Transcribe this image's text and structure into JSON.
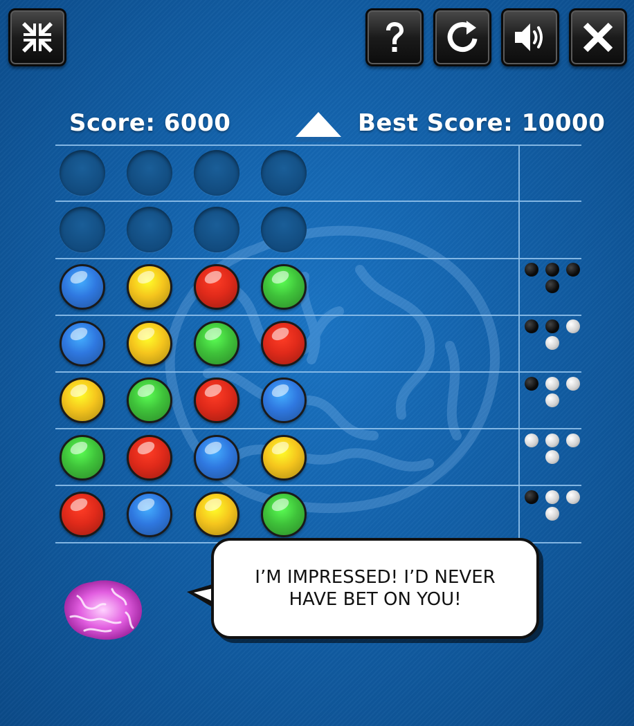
{
  "toolbar": {
    "buttons": [
      {
        "name": "fullscreen-toggle-button",
        "icon": "compress-arrows-icon"
      },
      {
        "name": "help-button",
        "icon": "question-mark-icon"
      },
      {
        "name": "restart-button",
        "icon": "restart-icon"
      },
      {
        "name": "sound-button",
        "icon": "speaker-icon"
      },
      {
        "name": "close-button",
        "icon": "close-icon"
      }
    ]
  },
  "score": {
    "label": "Score: 6000",
    "value": 6000
  },
  "best_score": {
    "label": "Best Score: 10000",
    "value": 10000
  },
  "colors": {
    "blue": "#2f78e0",
    "yellow": "#f5c51d",
    "red": "#e02a1a",
    "green": "#3fc23a"
  },
  "board": {
    "rows": [
      {
        "pegs": [
          "empty",
          "empty",
          "empty",
          "empty"
        ],
        "hints": []
      },
      {
        "pegs": [
          "empty",
          "empty",
          "empty",
          "empty"
        ],
        "hints": []
      },
      {
        "pegs": [
          "blue",
          "yellow",
          "red",
          "green"
        ],
        "hints": [
          "black",
          "black",
          "black",
          "black"
        ]
      },
      {
        "pegs": [
          "blue",
          "yellow",
          "green",
          "red"
        ],
        "hints": [
          "black",
          "black",
          "white",
          "white"
        ]
      },
      {
        "pegs": [
          "yellow",
          "green",
          "red",
          "blue"
        ],
        "hints": [
          "black",
          "white",
          "white",
          "white"
        ]
      },
      {
        "pegs": [
          "green",
          "red",
          "blue",
          "yellow"
        ],
        "hints": [
          "white",
          "white",
          "white",
          "white"
        ]
      },
      {
        "pegs": [
          "red",
          "blue",
          "yellow",
          "green"
        ],
        "hints": [
          "black",
          "white",
          "white",
          "white"
        ]
      }
    ]
  },
  "message": {
    "line1": "I’M IMPRESSED! I’D NEVER",
    "line2": "HAVE BET ON YOU!"
  }
}
